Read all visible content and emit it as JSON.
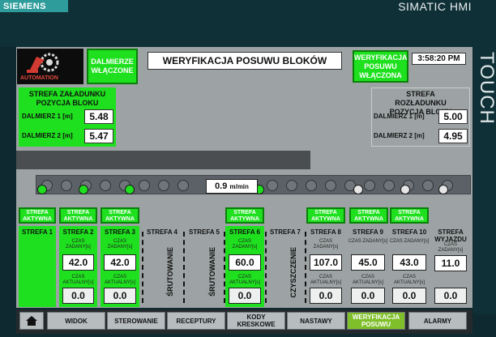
{
  "brand": "SIEMENS",
  "hmi_title": "SIMATIC HMI",
  "touch": "TOUCH",
  "logo_text": "AUTOMATION",
  "dalmierze_btn": "DALMIERZE WŁĄCZONE",
  "title": "WERYFIKACJA POSUWU BLOKÓW",
  "weryf_btn": "WERYFIKACJA POSUWU WŁĄCZONA",
  "clock": "3:58:20 PM",
  "load_zone": {
    "title": "STREFA ZAŁADUNKU POZYCJA BLOKU",
    "d1_label": "DALMIERZ 1 [m]",
    "d1_value": "5.48",
    "d2_label": "DALMIERZ 2 [m]",
    "d2_value": "5.47"
  },
  "unload_zone": {
    "title": "STREFA ROZŁADUNKU POZYCJA BLOKU",
    "d1_label": "DALMIERZ 1 [m]",
    "d1_value": "5.00",
    "d2_label": "DALMIERZ 2 [m]",
    "d2_value": "4.95"
  },
  "speed": {
    "value": "0.9",
    "unit": "m/min"
  },
  "active_label": "STREFA AKTYWNA",
  "zones": [
    {
      "name": "STREFA 1",
      "active": true
    },
    {
      "name": "STREFA 2",
      "active": true,
      "set_label": "CZAS ZADANY[s]",
      "set": "42.0",
      "act_label": "CZAS AKTUALNY[s]",
      "act": "0.0"
    },
    {
      "name": "STREFA 3",
      "active": true,
      "set_label": "CZAS ZADANY[s]",
      "set": "42.0",
      "act_label": "CZAS AKTUALNY[s]",
      "act": "0.0"
    },
    {
      "name": "STREFA 4",
      "active": false,
      "vertical": "ŚRUTOWANIE"
    },
    {
      "name": "STREFA 5",
      "active": false,
      "vertical": "ŚRUTOWANIE"
    },
    {
      "name": "STREFA 6",
      "active": true,
      "set_label": "CZAS ZADANY[s]",
      "set": "60.0",
      "act_label": "CZAS AKTUALNY[s]",
      "act": "0.0"
    },
    {
      "name": "STREFA 7",
      "active": false,
      "vertical": "CZYSZCZENIE"
    },
    {
      "name": "STREFA 8",
      "active": false,
      "set_label": "CZAS ZADANY[s]",
      "set": "107.0",
      "act_label": "CZAS AKTUALNY[s]",
      "act": "0.0"
    },
    {
      "name": "STREFA 9",
      "active": false,
      "set_label": "CZAS ZADANY[s]",
      "set": "45.0",
      "act_label": "CZAS AKTUALNY[s]",
      "act": "0.0"
    },
    {
      "name": "STREFA 10",
      "active": false,
      "set_label": "CZAS ZADANY[s]",
      "set": "43.0",
      "act_label": "CZAS AKTUALNY[s]",
      "act": "0.0"
    },
    {
      "name": "STREFA WYJAZDU",
      "active": false,
      "set_label": "CZAS ZADANY[s]",
      "set": "11.0",
      "act": "0.0"
    }
  ],
  "nav": {
    "widok": "WIDOK",
    "sterowanie": "STEROWANIE",
    "receptury": "RECEPTURY",
    "kody": "KODY KRESKOWE",
    "nastawy": "NASTAWY",
    "weryfikacja": "WERYFIKACJA POSUWU",
    "alarmy": "ALARMY"
  },
  "colors": {
    "active_green": "#1ee01e",
    "panel_grey": "#9da3a4",
    "nav_active": "#7fbf2a"
  }
}
